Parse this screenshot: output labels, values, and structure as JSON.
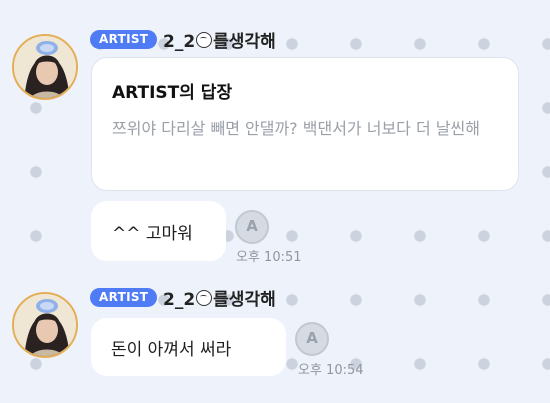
{
  "messages": [
    {
      "badge": "ARTIST",
      "sender": {
        "part1": "2_2",
        "part2": "를생각해"
      },
      "reply": {
        "title": "ARTIST의 답장",
        "body": "쯔위야 다리살 빼면 안댈까? 백댄서가 너보다 더 날씬해"
      }
    },
    {
      "text": "^^ 고마워",
      "time": "오후 10:51"
    },
    {
      "badge": "ARTIST",
      "sender": {
        "part1": "2_2",
        "part2": "를생각해"
      },
      "text": "돈이 아껴서 써라",
      "time": "오후 10:54"
    }
  ],
  "icons": {
    "reaction": "lightstick-icon",
    "sender_emoji": "face-emoji-icon"
  },
  "colors": {
    "badge": "#4f7bf5",
    "avatar_border": "#e4ae57",
    "background": "#eef3fb"
  }
}
